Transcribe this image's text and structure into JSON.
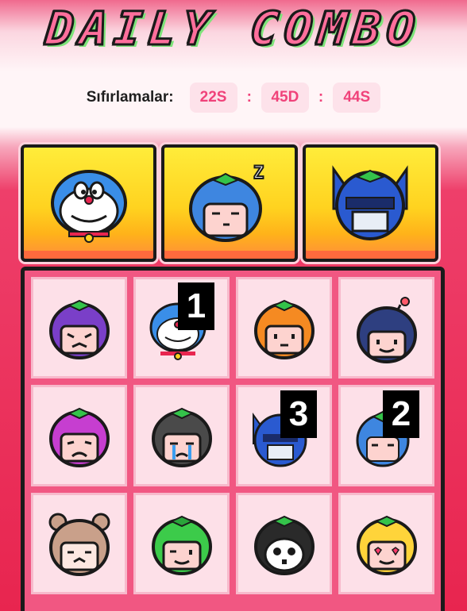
{
  "header": {
    "title": "DAILY COMBO"
  },
  "reset": {
    "label": "Sıfırlamalar:",
    "hours": "22S",
    "minutes": "45D",
    "seconds": "44S",
    "separator": ":"
  },
  "combo_slots": [
    {
      "icon": "cat-robot-character-icon"
    },
    {
      "icon": "sleeping-blue-character-icon"
    },
    {
      "icon": "robot-helmet-character-icon"
    }
  ],
  "grid": {
    "cells": [
      {
        "icon": "purple-angry-character-icon",
        "badge": ""
      },
      {
        "icon": "cat-robot-character-icon",
        "badge": "1"
      },
      {
        "icon": "orange-character-icon",
        "badge": ""
      },
      {
        "icon": "bomb-character-icon",
        "badge": ""
      },
      {
        "icon": "magenta-sad-character-icon",
        "badge": ""
      },
      {
        "icon": "crying-gray-character-icon",
        "badge": ""
      },
      {
        "icon": "robot-helmet-character-icon",
        "badge": "3"
      },
      {
        "icon": "sleeping-blue-character-icon",
        "badge": "2"
      },
      {
        "icon": "bear-hood-character-icon",
        "badge": ""
      },
      {
        "icon": "green-character-icon",
        "badge": ""
      },
      {
        "icon": "panda-character-icon",
        "badge": ""
      },
      {
        "icon": "yellow-heart-eyes-character-icon",
        "badge": ""
      }
    ]
  },
  "colors": {
    "accent": "#f0427a",
    "panel": "#f15782",
    "slot_yellow": "#ffd21f"
  }
}
